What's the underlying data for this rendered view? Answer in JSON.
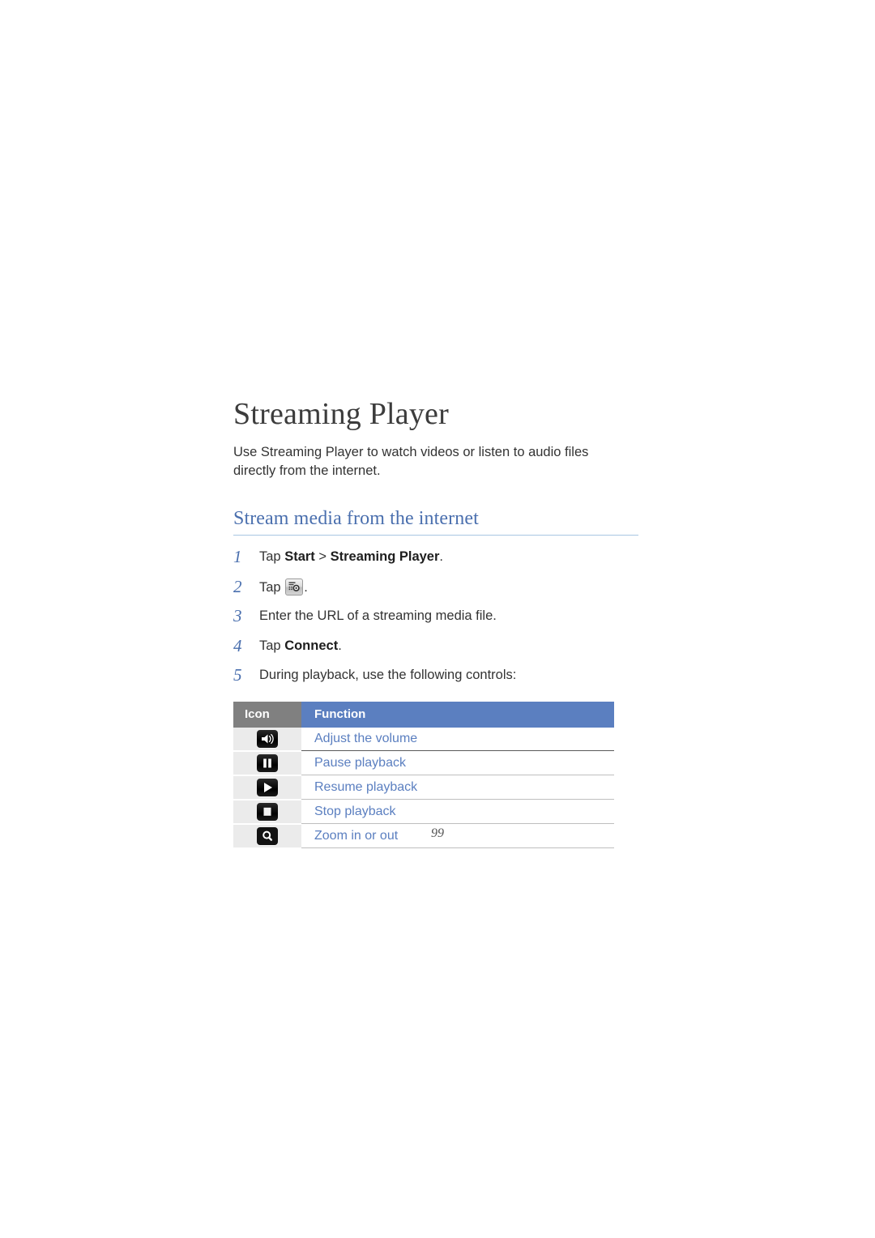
{
  "document": {
    "chapter_title": "Streaming Player",
    "intro": "Use Streaming Player to watch videos or listen to audio files directly from the internet.",
    "page_number": "99"
  },
  "section": {
    "heading": "Stream media from the internet"
  },
  "steps": [
    {
      "number": "1",
      "prefix": "Tap ",
      "bold1": "Start",
      "middle": " > ",
      "bold2": "Streaming Player",
      "suffix": ".",
      "icon": null
    },
    {
      "number": "2",
      "prefix": "Tap ",
      "bold1": "",
      "middle": "",
      "bold2": "",
      "suffix": ".",
      "icon": "streaming-connect-icon"
    },
    {
      "number": "3",
      "prefix": "Enter the URL of a streaming media file.",
      "bold1": "",
      "middle": "",
      "bold2": "",
      "suffix": "",
      "icon": null
    },
    {
      "number": "4",
      "prefix": "Tap ",
      "bold1": "Connect",
      "middle": "",
      "bold2": "",
      "suffix": ".",
      "icon": null
    },
    {
      "number": "5",
      "prefix": "During playback, use the following controls:",
      "bold1": "",
      "middle": "",
      "bold2": "",
      "suffix": "",
      "icon": null
    }
  ],
  "controls_table": {
    "headers": {
      "icon": "Icon",
      "function": "Function"
    },
    "rows": [
      {
        "icon_name": "volume-icon",
        "function": "Adjust the volume"
      },
      {
        "icon_name": "pause-icon",
        "function": "Pause playback"
      },
      {
        "icon_name": "play-icon",
        "function": "Resume playback"
      },
      {
        "icon_name": "stop-icon",
        "function": "Stop playback"
      },
      {
        "icon_name": "zoom-icon",
        "function": "Zoom in or out"
      }
    ]
  },
  "colors": {
    "heading_blue": "#4a6fae",
    "table_header_blue": "#5b7fc0",
    "table_header_gray": "#808080",
    "function_text_blue": "#5b7fc0",
    "title_gray": "#3c3c3c",
    "rule_blue": "#a9c6e2"
  }
}
